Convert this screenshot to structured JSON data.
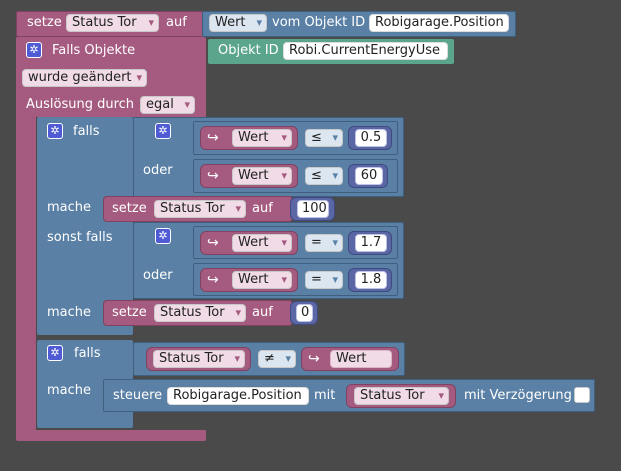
{
  "top": {
    "setze": "setze",
    "variable": "Status Tor",
    "auf": "auf",
    "wert": "Wert",
    "vom_objekt_id": "vom Objekt ID",
    "objekt_id_value": "Robigarage.Position"
  },
  "trigger": {
    "falls_objekte": "Falls Objekte",
    "objekt_id_label": "Objekt ID",
    "objekt_id_value": "Robi.CurrentEnergyUse",
    "wurde_geaendert": "wurde geändert",
    "ausloesung_durch": "Auslösung durch",
    "ausloesung_value": "egal"
  },
  "if1": {
    "falls": "falls",
    "cond1": {
      "value_label": "Wert",
      "op": "≤",
      "num": "0.5"
    },
    "oder": "oder",
    "cond2": {
      "value_label": "Wert",
      "op": "≤",
      "num": "60"
    },
    "mache": "mache",
    "action": {
      "setze": "setze",
      "variable": "Status Tor",
      "auf": "auf",
      "num": "100"
    },
    "sonst_falls": "sonst falls",
    "cond3": {
      "value_label": "Wert",
      "op": "=",
      "num": "1.7"
    },
    "oder2": "oder",
    "cond4": {
      "value_label": "Wert",
      "op": "=",
      "num": "1.8"
    },
    "mache2": "mache",
    "action2": {
      "setze": "setze",
      "variable": "Status Tor",
      "auf": "auf",
      "num": "0"
    }
  },
  "if2": {
    "falls": "falls",
    "variable": "Status Tor",
    "op": "≠",
    "value_label": "Wert",
    "mache": "mache",
    "steuere": "steuere",
    "object": "Robigarage.Position",
    "mit": "mit",
    "status_var": "Status Tor",
    "mit_verzoegerung": "mit Verzögerung"
  },
  "colors": {
    "background": "#4a4a4a",
    "trigger_block": "#a55b80",
    "logic_block": "#5b80a5",
    "math_block": "#5b67a5",
    "object_id_block": "#5ba58c",
    "gear": "#4f5bd5"
  }
}
